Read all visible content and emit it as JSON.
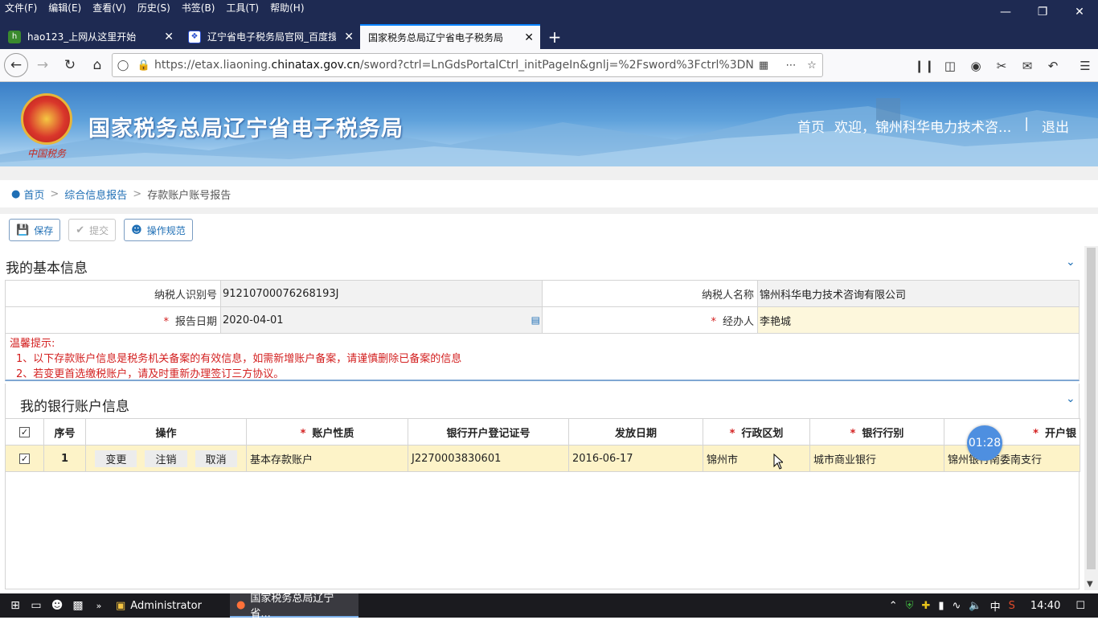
{
  "browser": {
    "menus": [
      "文件(F)",
      "编辑(E)",
      "查看(V)",
      "历史(S)",
      "书签(B)",
      "工具(T)",
      "帮助(H)"
    ],
    "tabs": [
      {
        "label": "hao123_上网从这里开始"
      },
      {
        "label": "辽宁省电子税务局官网_百度搜索"
      },
      {
        "label": "国家税务总局辽宁省电子税务局"
      }
    ],
    "url_prefix": "https://etax.liaoning.",
    "url_domain": "chinatax.gov.cn",
    "url_rest": "/sword?ctrl=LnGdsPortalCtrl_initPageIn&gnlj=%2Fsword%3Fctrl%3DN"
  },
  "site": {
    "emblem_text": "中国税务",
    "title": "国家税务总局辽宁省电子税务局",
    "home": "首页",
    "welcome": "欢迎，锦州科华电力技术咨...",
    "divider": "|",
    "logout": "退出"
  },
  "breadcrumb": {
    "home": "首页",
    "level1": "综合信息报告",
    "current": "存款账户账号报告",
    "sep": ">"
  },
  "toolbar": {
    "save": "保存",
    "submit": "提交",
    "guide": "操作规范"
  },
  "basic": {
    "title": "我的基本信息",
    "taxpayer_id_label": "纳税人识别号",
    "taxpayer_id": "91210700076268193J",
    "taxpayer_name_label": "纳税人名称",
    "taxpayer_name": "锦州科华电力技术咨询有限公司",
    "report_date_label": "报告日期",
    "report_date": "2020-04-01",
    "handler_label": "经办人",
    "handler": "李艳城",
    "required_mark": "*"
  },
  "tips": {
    "title": "温馨提示:",
    "line1": "1、以下存款账户信息是税务机关备案的有效信息，如需新增账户备案，请谨慎删除已备案的信息",
    "line2": "2、若变更首选缴税账户，请及时重新办理签订三方协议。"
  },
  "bank": {
    "title": "我的银行账户信息",
    "headers": {
      "seq": "序号",
      "op": "操作",
      "nature": "账户性质",
      "license": "银行开户登记证号",
      "issue_date": "发放日期",
      "region": "行政区划",
      "bank_type": "银行行别",
      "branch": "开户银"
    },
    "rows": [
      {
        "seq": "1",
        "op_change": "变更",
        "op_cancel": "注销",
        "op_revoke": "取消",
        "nature": "基本存款账户",
        "license": "J2270003830601",
        "issue_date": "2016-06-17",
        "region": "锦州市",
        "bank_type": "城市商业银行",
        "branch": "锦州银行南委南支行"
      }
    ]
  },
  "timer": "01:28",
  "taskbar": {
    "explorer": "Administrator",
    "browser": "国家税务总局辽宁省...",
    "ime": "中",
    "clock": "14:40"
  }
}
